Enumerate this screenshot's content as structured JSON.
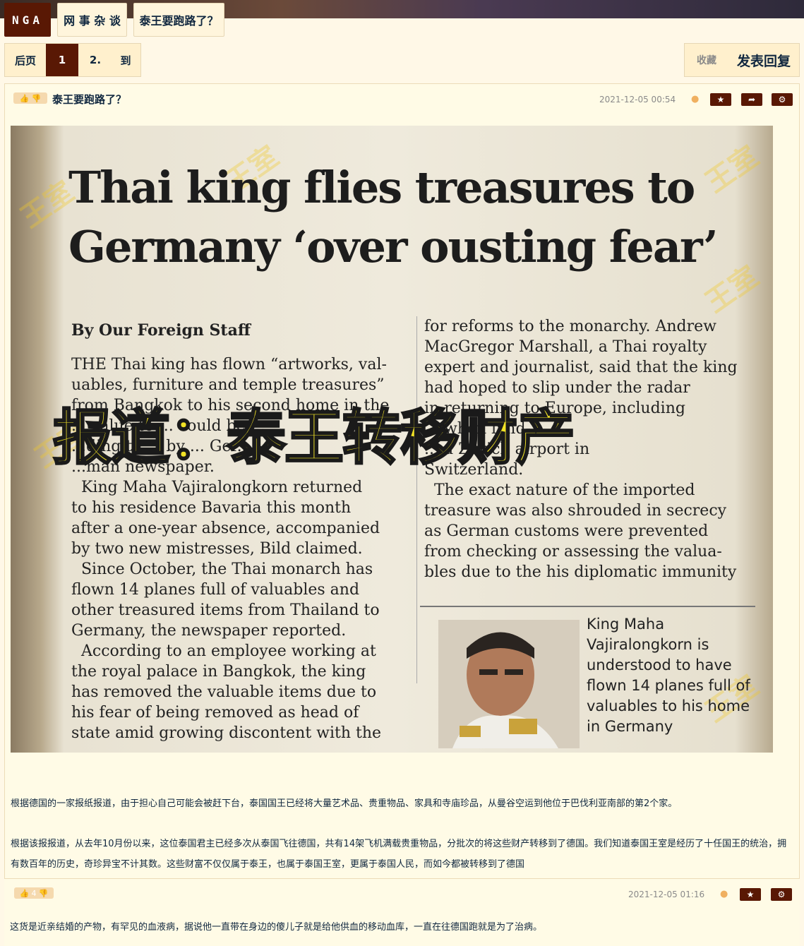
{
  "nav": {
    "logo": "NGA",
    "forum": "网 事 杂 谈",
    "thread": "泰王要跑路了？"
  },
  "pager": {
    "prev": "后页",
    "current": "1",
    "next": "2.",
    "goto": "到"
  },
  "actions": {
    "favorite": "收藏",
    "reply": "发表回复"
  },
  "post": {
    "title": "泰王要跑路了？",
    "timestamp": "2021-12-05 00:54",
    "image": {
      "headline_line1": "Thai king flies treasures to",
      "headline_line2": "Germany ‘over ousting fear’",
      "byline": "By Our Foreign Staff",
      "left_col": [
        "THE Thai king has flown “artworks, val-",
        "uables, furniture and temple treasures”",
        "from Bangkok to his second home in the",
        "... value to ... could be ...",
        "...ding to ... by ... Ger...",
        "...man newspaper.",
        "  King Maha Vajiralongkorn returned",
        "to his residence Bavaria this month",
        "after a one-year absence, accompanied",
        "by two new mistresses, Bild claimed.",
        "  Since October, the Thai monarch has",
        "flown 14 planes full of valuables and",
        "other treasured items from Thailand to",
        "Germany, the newspaper reported.",
        "  According to an employee working at",
        "the royal palace in Bangkok, the king",
        "has removed the valuable items due to",
        "his fear of being removed as head of",
        "state amid growing discontent with the"
      ],
      "right_col": [
        "for reforms to the monarchy. Andrew",
        "MacGregor Marshall, a Thai royalty",
        "expert and journalist, said that the king",
        "had hoped to slip under the radar",
        "in returning to Europe, including",
        "... when land-",
        "... a Zurich airport in",
        "Switzerland.",
        "  The exact nature of the imported",
        "treasure was also shrouded in secrecy",
        "as German customs were prevented",
        "from checking or assessing the valua-",
        "bles due to the his diplomatic immunity"
      ],
      "caption": "King Maha Vajiralongkorn is understood to have flown 14 planes full of valuables to his home in Germany",
      "overlay": "报道：泰王转移财产",
      "watermark": "王室"
    },
    "paragraph1": "根据德国的一家报纸报道，由于担心自己可能会被赶下台，泰国国王已经将大量艺术品、贵重物品、家具和寺庙珍品，从曼谷空运到他位于巴伐利亚南部的第2个家。",
    "paragraph2": "根据该报报道，从去年10月份以来，这位泰国君主已经多次从泰国飞往德国，共有14架飞机满载贵重物品，分批次的将这些财产转移到了德国。我们知道泰国王室是经历了十任国王的统治，拥有数百年的历史，奇珍异宝不计其数。这些财富不仅仅属于泰王，也属于泰国王室，更属于泰国人民，而如今都被转移到了德国"
  },
  "reply": {
    "votes": "4",
    "timestamp": "2021-12-05 01:16",
    "text": "这货是近亲结婚的产物，有罕见的血液病，据说他一直带在身边的傻儿子就是给他供血的移动血库，一直在往德国跑就是为了治病。"
  }
}
